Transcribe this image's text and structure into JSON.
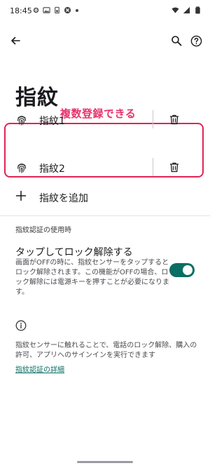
{
  "status_bar": {
    "time": "18:45",
    "left_icons": [
      "gear-icon",
      "photo-icon",
      "battery-saver-icon",
      "blocked-icon"
    ],
    "right_icons": [
      "wifi-icon",
      "signal-icon",
      "battery-icon"
    ]
  },
  "app_bar": {
    "back_icon": "arrow-back-icon",
    "search_icon": "search-icon",
    "help_icon": "help-icon"
  },
  "page": {
    "title": "指紋",
    "annotation": "複数登録できる",
    "annotation_color": "#e8336e"
  },
  "fingerprints": [
    {
      "label": "指紋1",
      "icon": "fingerprint-icon",
      "delete_icon": "trash-icon"
    },
    {
      "label": "指紋2",
      "icon": "fingerprint-icon",
      "delete_icon": "trash-icon"
    }
  ],
  "add_fingerprint": {
    "label": "指紋を追加",
    "icon": "plus-icon"
  },
  "section": {
    "header": "指紋認証の使用時"
  },
  "unlock_setting": {
    "title": "タップしてロック解除する",
    "description": "画面がOFFの時に、指紋センサーをタップするとロック解除されます。この機能がOFFの場合、ロック解除には電源キーを押すことが必要になります。",
    "toggle_on": true,
    "accent_color": "#0b6e63"
  },
  "info": {
    "icon": "info-icon",
    "text": "指紋センサーに触れることで、電話のロック解除、購入の許可、アプリへのサインインを実行できます",
    "link": "指紋認証の詳細"
  }
}
